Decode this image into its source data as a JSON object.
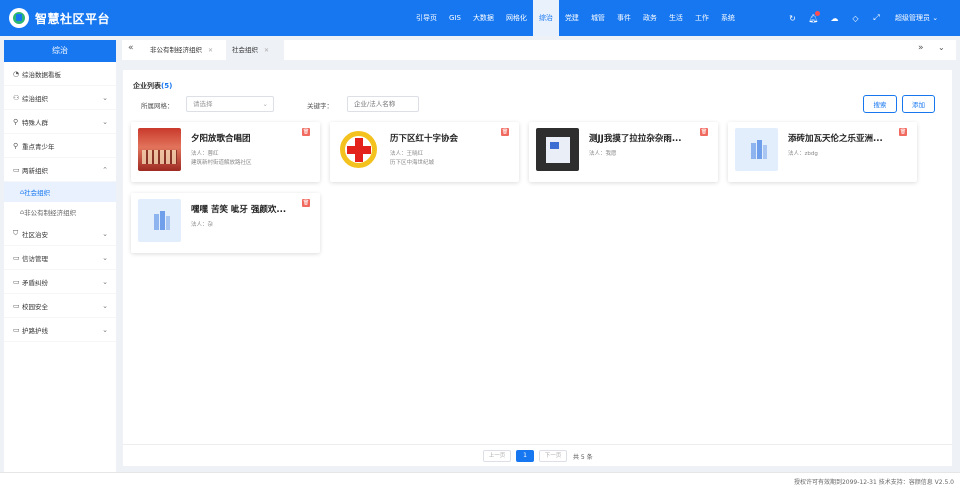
{
  "app": {
    "title": "智慧社区平台"
  },
  "nav": {
    "items": [
      {
        "label": "引导页"
      },
      {
        "label": "GIS"
      },
      {
        "label": "大数据"
      },
      {
        "label": "网格化"
      },
      {
        "label": "综治",
        "active": true
      },
      {
        "label": "党建"
      },
      {
        "label": "城管"
      },
      {
        "label": "事件"
      },
      {
        "label": "政务"
      },
      {
        "label": "生活"
      },
      {
        "label": "工作"
      },
      {
        "label": "系统"
      }
    ],
    "user": "超级管理员"
  },
  "sidebar": {
    "header": "综治",
    "items": [
      {
        "label": "综治数据看板",
        "icon": "dashboard-icon",
        "expandable": false
      },
      {
        "label": "综治组织",
        "icon": "org-icon",
        "expandable": true
      },
      {
        "label": "特殊人群",
        "icon": "person-icon",
        "expandable": true
      },
      {
        "label": "重点青少年",
        "icon": "person-icon",
        "expandable": false
      },
      {
        "label": "两新组织",
        "icon": "folder-icon",
        "expandable": true,
        "open": true,
        "children": [
          {
            "label": "社会组织",
            "active": true
          },
          {
            "label": "非公有制经济组织"
          }
        ]
      },
      {
        "label": "社区治安",
        "icon": "shield-icon",
        "expandable": true
      },
      {
        "label": "信访管理",
        "icon": "folder-icon",
        "expandable": true
      },
      {
        "label": "矛盾纠纷",
        "icon": "folder-icon",
        "expandable": true
      },
      {
        "label": "校园安全",
        "icon": "folder-icon",
        "expandable": true
      },
      {
        "label": "护路护线",
        "icon": "folder-icon",
        "expandable": true
      }
    ]
  },
  "tabs": [
    {
      "label": "非公有制经济组织",
      "active": false
    },
    {
      "label": "社会组织",
      "active": true
    }
  ],
  "list": {
    "title": "企业列表",
    "count": "(5)",
    "filter_grid_label": "所属网格：",
    "filter_grid_placeholder": "请选择",
    "keyword_label": "关键字：",
    "keyword_placeholder": "企业/法人名称",
    "search_button": "搜索",
    "add_button": "添加"
  },
  "cards": [
    {
      "name": "夕阳放歌合唱团",
      "legal": "法人：蓉红",
      "address": "建筑新村街道解放路社区",
      "thumb": "photo"
    },
    {
      "name": "历下区红十字协会",
      "legal": "法人：王晓红",
      "address": "历下区中海世纪城",
      "thumb": "cross"
    },
    {
      "name": "测JJ我摸了拉拉杂杂雨...",
      "legal": "法人：我愿",
      "address": "",
      "thumb": "shot"
    },
    {
      "name": "添砖加瓦天伦之乐亚洲...",
      "legal": "法人：zbdg",
      "address": "",
      "thumb": "placeholder"
    },
    {
      "name": "嘿嘿 苦笑 呲牙 强颜欢...",
      "legal": "法人：杂",
      "address": "",
      "thumb": "placeholder"
    }
  ],
  "pagination": {
    "prev": "上一页",
    "current": "1",
    "next": "下一页",
    "total": "共 5 条"
  },
  "footer": {
    "text": "授权许可有效期到2099-12-31  技术支持：容颜信息  V2.5.0"
  },
  "colors": {
    "primary": "#1677f0",
    "danger": "#f06a5f",
    "background": "#eef1f6"
  }
}
